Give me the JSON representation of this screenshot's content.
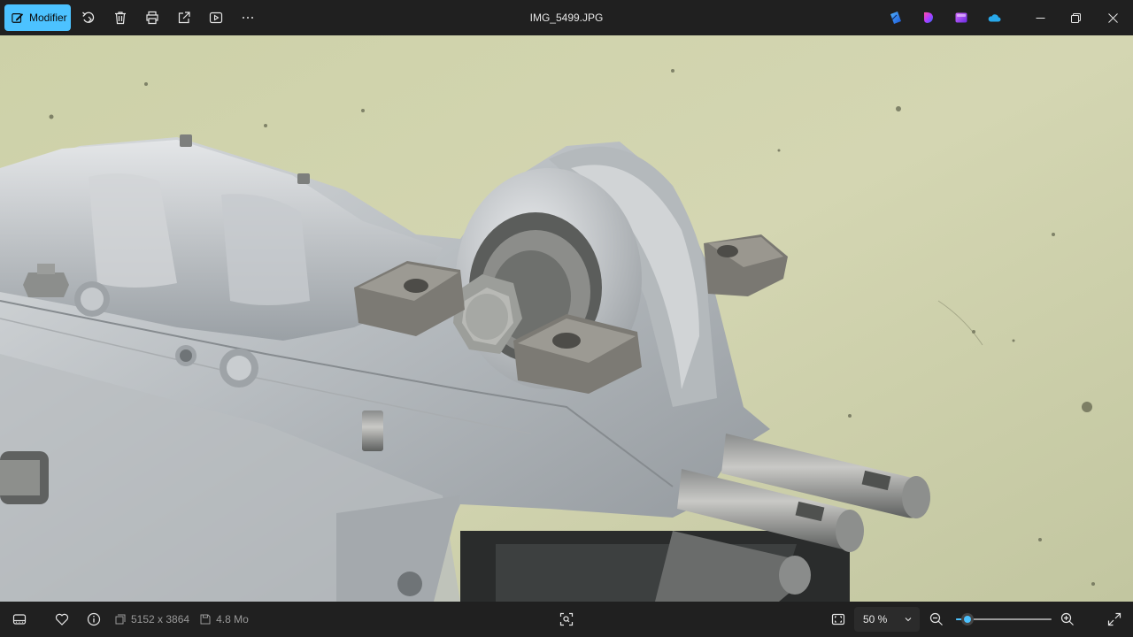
{
  "toolbar": {
    "edit_label": "Modifier",
    "icons": [
      "edit-icon",
      "rotate-icon",
      "delete-icon",
      "print-icon",
      "share-icon",
      "slideshow-icon",
      "more-icon"
    ]
  },
  "window": {
    "title": "IMG_5499.JPG",
    "apps": [
      "clipchamp-icon",
      "designer-icon",
      "photos-icon",
      "onedrive-icon"
    ],
    "controls": [
      "minimize-icon",
      "restore-icon",
      "close-icon"
    ]
  },
  "image": {
    "description_name": "photo-gearbox",
    "colors": {
      "background": "#cfd0a8",
      "metal": "#c8ccce",
      "accent": "#4cc2ff"
    }
  },
  "statusbar": {
    "dimensions": "5152 x 3864",
    "file_size": "4.8 Mo",
    "zoom": {
      "label": "50 %",
      "value_fraction": 0.12
    }
  }
}
